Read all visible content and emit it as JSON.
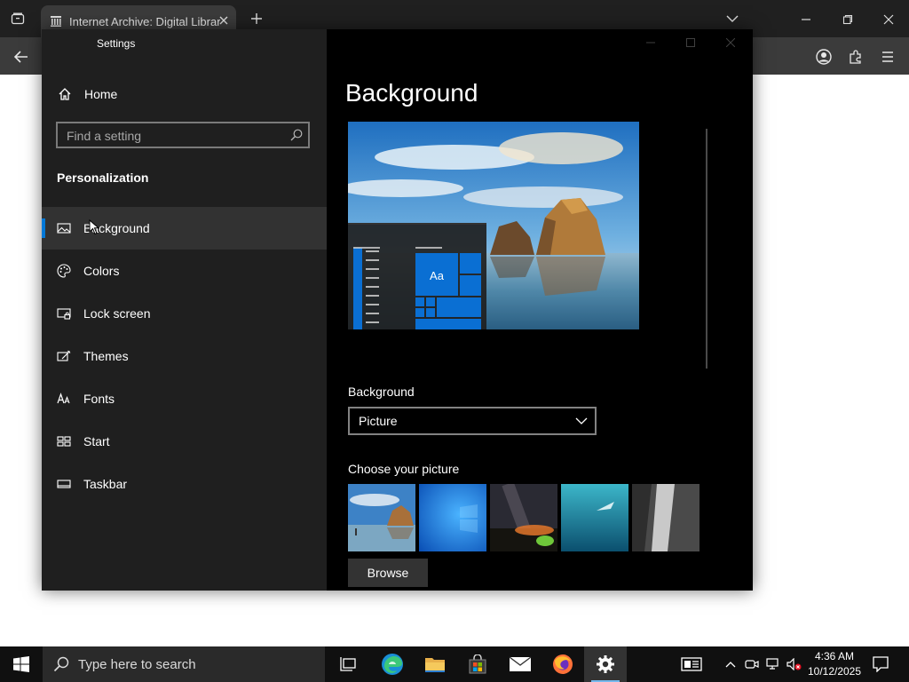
{
  "browser": {
    "tab_title": "Internet Archive: Digital Library"
  },
  "settings": {
    "window_title": "Settings",
    "home_label": "Home",
    "search_placeholder": "Find a setting",
    "section_title": "Personalization",
    "nav": [
      {
        "label": "Background",
        "icon": "picture-icon",
        "selected": true
      },
      {
        "label": "Colors",
        "icon": "palette-icon"
      },
      {
        "label": "Lock screen",
        "icon": "lock-screen-icon"
      },
      {
        "label": "Themes",
        "icon": "themes-icon"
      },
      {
        "label": "Fonts",
        "icon": "fonts-icon"
      },
      {
        "label": "Start",
        "icon": "start-icon"
      },
      {
        "label": "Taskbar",
        "icon": "taskbar-icon"
      }
    ],
    "main": {
      "page_title": "Background",
      "preview_tile_text": "Aa",
      "background_label": "Background",
      "background_value": "Picture",
      "choose_label": "Choose your picture",
      "browse_label": "Browse"
    }
  },
  "taskbar": {
    "search_placeholder": "Type here to search",
    "time": "4:36 AM",
    "date": "10/12/2025"
  },
  "colors": {
    "accent": "#0078d7",
    "tile_blue": "#0a6fd3"
  }
}
